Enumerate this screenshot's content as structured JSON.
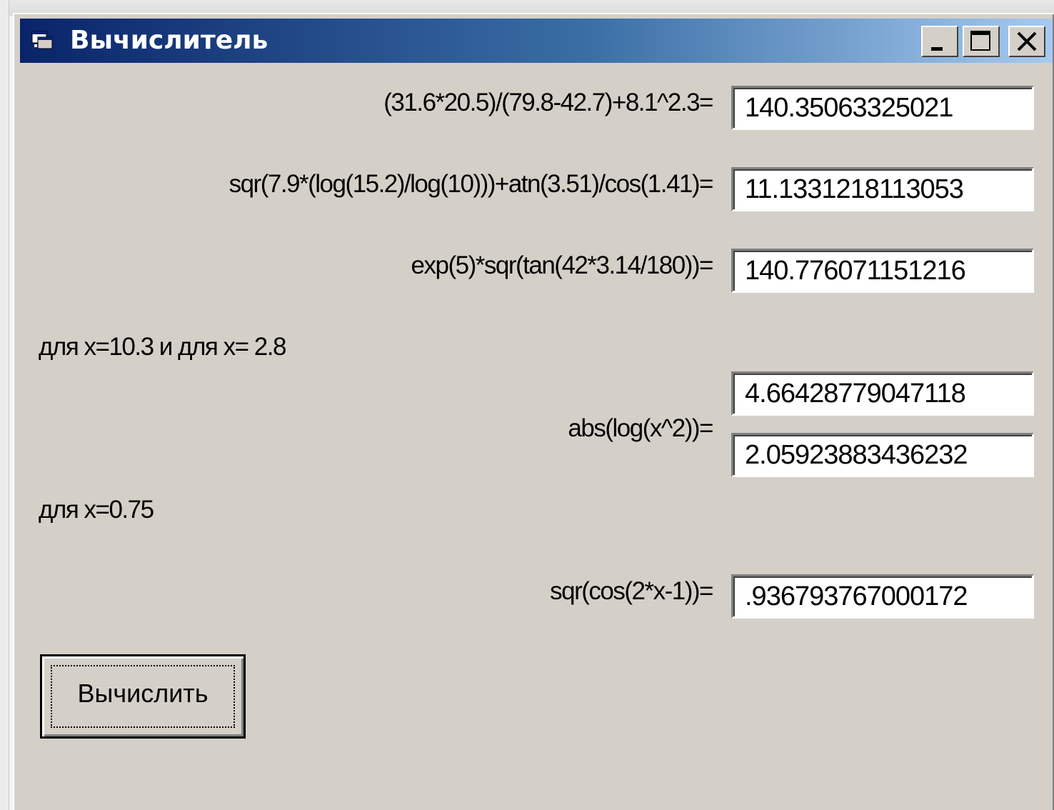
{
  "window": {
    "title": "Вычислитель"
  },
  "expressions": [
    {
      "label": "(31.6*20.5)/(79.8-42.7)+8.1^2.3=",
      "value": "140.35063325021"
    },
    {
      "label": "sqr(7.9*(log(15.2)/log(10)))+atn(3.51)/cos(1.41)=",
      "value": "11.1331218113053"
    },
    {
      "label": "exp(5)*sqr(tan(42*3.14/180))=",
      "value": "140.776071151216"
    }
  ],
  "abs_section": {
    "note": "для x=10.3 и для x= 2.8",
    "label": "abs(log(x^2))=",
    "values": [
      "4.66428779047118",
      "2.05923883436232"
    ]
  },
  "cos_section": {
    "note": "для x=0.75",
    "label": "sqr(cos(2*x-1))=",
    "value": ".936793767000172"
  },
  "button": {
    "label": "Вычислить"
  },
  "colors": {
    "window_bg": "#d4d0c8",
    "titlebar_start": "#0a246a",
    "titlebar_end": "#a6caf0"
  }
}
